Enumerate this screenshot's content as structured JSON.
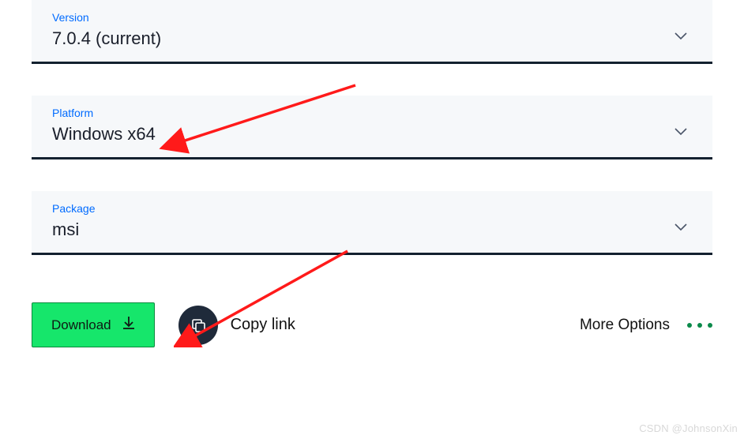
{
  "selects": {
    "version": {
      "label": "Version",
      "value": "7.0.4 (current)"
    },
    "platform": {
      "label": "Platform",
      "value": "Windows x64"
    },
    "package": {
      "label": "Package",
      "value": "msi"
    }
  },
  "actions": {
    "download": "Download",
    "copy": "Copy link",
    "more": "More Options"
  },
  "watermark": "CSDN @JohnsonXin"
}
